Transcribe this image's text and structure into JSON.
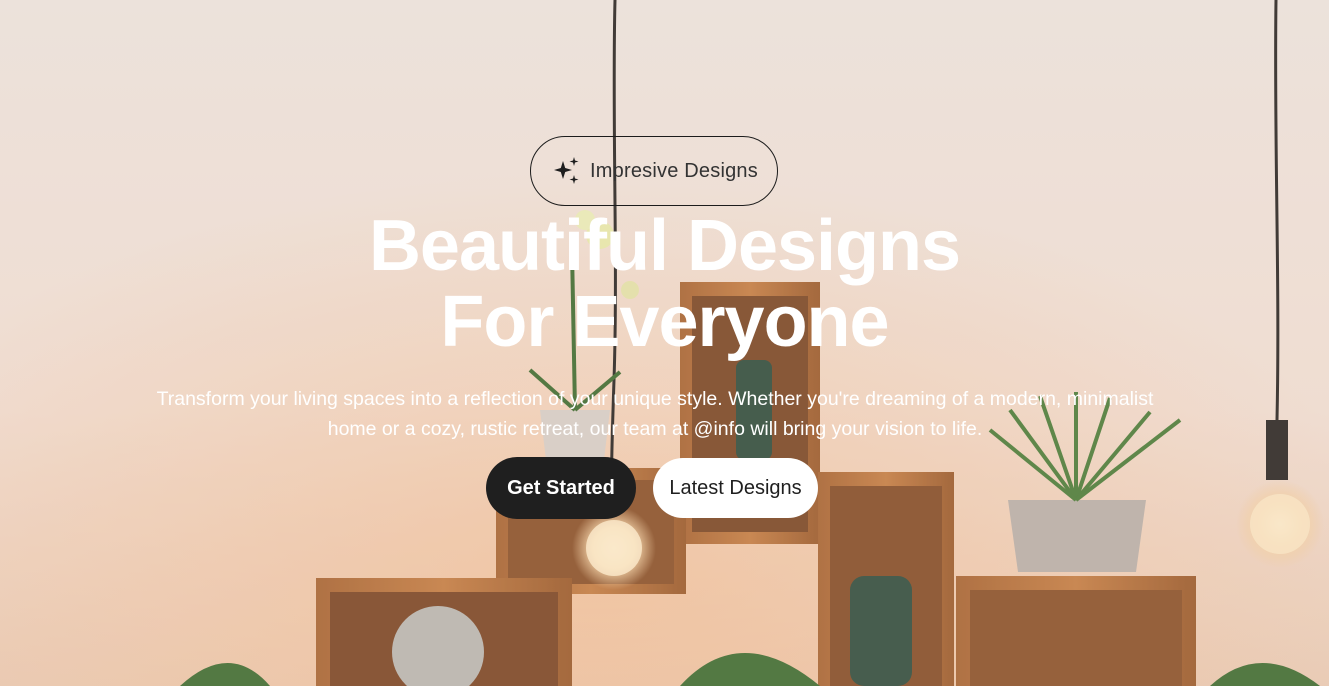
{
  "hero": {
    "badge_label": "Impresive Designs",
    "badge_icon": "sparkles-icon",
    "headline_line1": "Beautiful Designs",
    "headline_line2": "For Everyone",
    "subtext": "Transform your living spaces into a reflection of your unique style. Whether you're dreaming of a modern, minimalist home or a cozy, rustic retreat, our team at @info will bring your vision to life.",
    "primary_button": "Get Started",
    "secondary_button": "Latest Designs"
  },
  "colors": {
    "primary_button_bg": "#1f1f1f",
    "secondary_button_bg": "#ffffff",
    "headline": "#ffffff",
    "wall": "#f1e1d8"
  }
}
